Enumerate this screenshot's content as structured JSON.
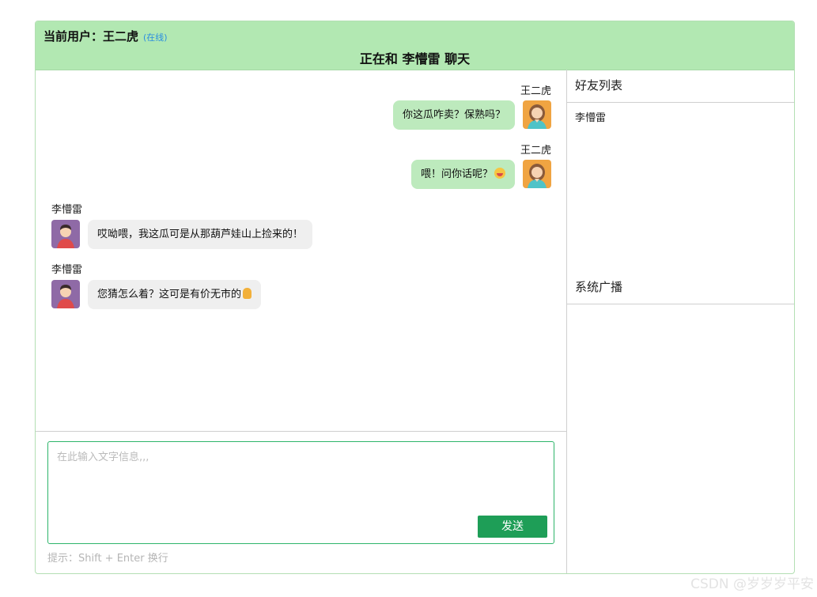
{
  "header": {
    "current_user_label": "当前用户：王二虎",
    "online_status": "(在线)",
    "chat_title": "正在和 李懵雷 聊天"
  },
  "messages": [
    {
      "side": "me",
      "sender": "王二虎",
      "text": "你这瓜咋卖？保熟吗？",
      "emoji": null
    },
    {
      "side": "me",
      "sender": "王二虎",
      "text": "喂！问你话呢？",
      "emoji": "laughing-emoji"
    },
    {
      "side": "them",
      "sender": "李懵雷",
      "text": "哎呦喂，我这瓜可是从那葫芦娃山上捡来的！",
      "emoji": null
    },
    {
      "side": "them",
      "sender": "李懵雷",
      "text": "您猜怎么着？这可是有价无市的",
      "emoji": "thumbs-up-emoji"
    }
  ],
  "input": {
    "placeholder": "在此输入文字信息,,,",
    "value": "",
    "send_label": "发送",
    "hint": "提示：Shift + Enter 换行"
  },
  "friends": {
    "title": "好友列表",
    "items": [
      "李懵雷"
    ]
  },
  "broadcast": {
    "title": "系统广播"
  },
  "watermark": "CSDN @岁岁岁平安",
  "colors": {
    "header_bg": "#b2e8b2",
    "my_bubble": "#bdeabd",
    "their_bubble": "#efefef",
    "send_button": "#1e9e57",
    "input_border": "#2db56a",
    "online_status": "#2a8ee0"
  }
}
